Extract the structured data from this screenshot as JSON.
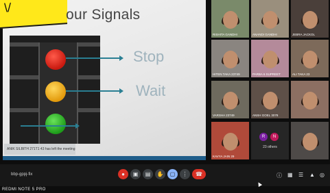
{
  "slide": {
    "title": "our Signals",
    "sticky_mark": "\\/",
    "labels": {
      "stop": "Stop",
      "wait": "Wait"
    },
    "toast": "ANIK SILBITH 271T1 43 has left the meeting"
  },
  "participants": [
    {
      "name": "RISHITA GANDHI"
    },
    {
      "name": "ANANDI GANDHI"
    },
    {
      "name": "JEBRA JACKOL"
    },
    {
      "name": "HITEN TAKA 23749"
    },
    {
      "name": "PARBA 6 SUPREET"
    },
    {
      "name": "ALI TAKA 23"
    },
    {
      "name": "VARSHA 23749"
    },
    {
      "name": "ANSH GOEL 3078"
    },
    {
      "name": ""
    },
    {
      "name": "KAVYA JAIN 29"
    },
    {
      "name": ""
    },
    {
      "name": ""
    }
  ],
  "others": {
    "initials": [
      "R",
      "N"
    ],
    "label": "23 others"
  },
  "controls": {
    "meeting_code": "bbp-gppj-fix",
    "buttons": [
      "●",
      "▣",
      "▤",
      "✋",
      "▢",
      "⋮",
      "☎"
    ],
    "right_icons": [
      "ⓘ",
      "▦",
      "☰",
      "▲",
      "◎"
    ]
  },
  "colors": {
    "accent": "#2a7f93",
    "end_call": "#d93025",
    "sticky": "#ffe81a"
  },
  "watermark": "REDMI NOTE 5 PRO"
}
